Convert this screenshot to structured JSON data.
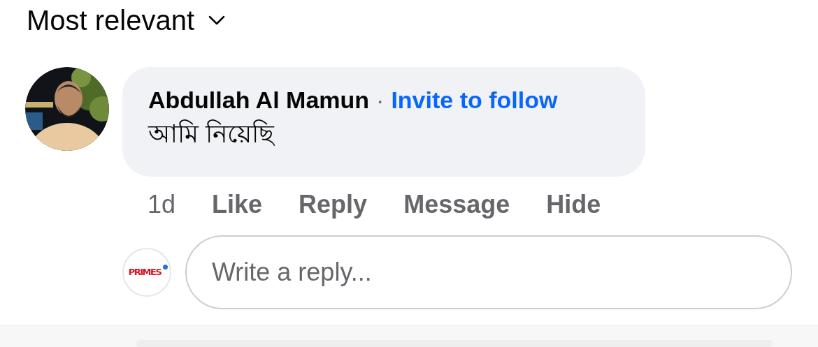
{
  "sort": {
    "label": "Most relevant"
  },
  "comment": {
    "author": "Abdullah Al Mamun",
    "separator": "·",
    "follow_link": "Invite to follow",
    "text": "আমি নিয়েছি",
    "time": "1d",
    "actions": [
      "Like",
      "Reply",
      "Message",
      "Hide"
    ]
  },
  "reply_box": {
    "avatar_text": "PRIMES",
    "placeholder": "Write a reply..."
  }
}
